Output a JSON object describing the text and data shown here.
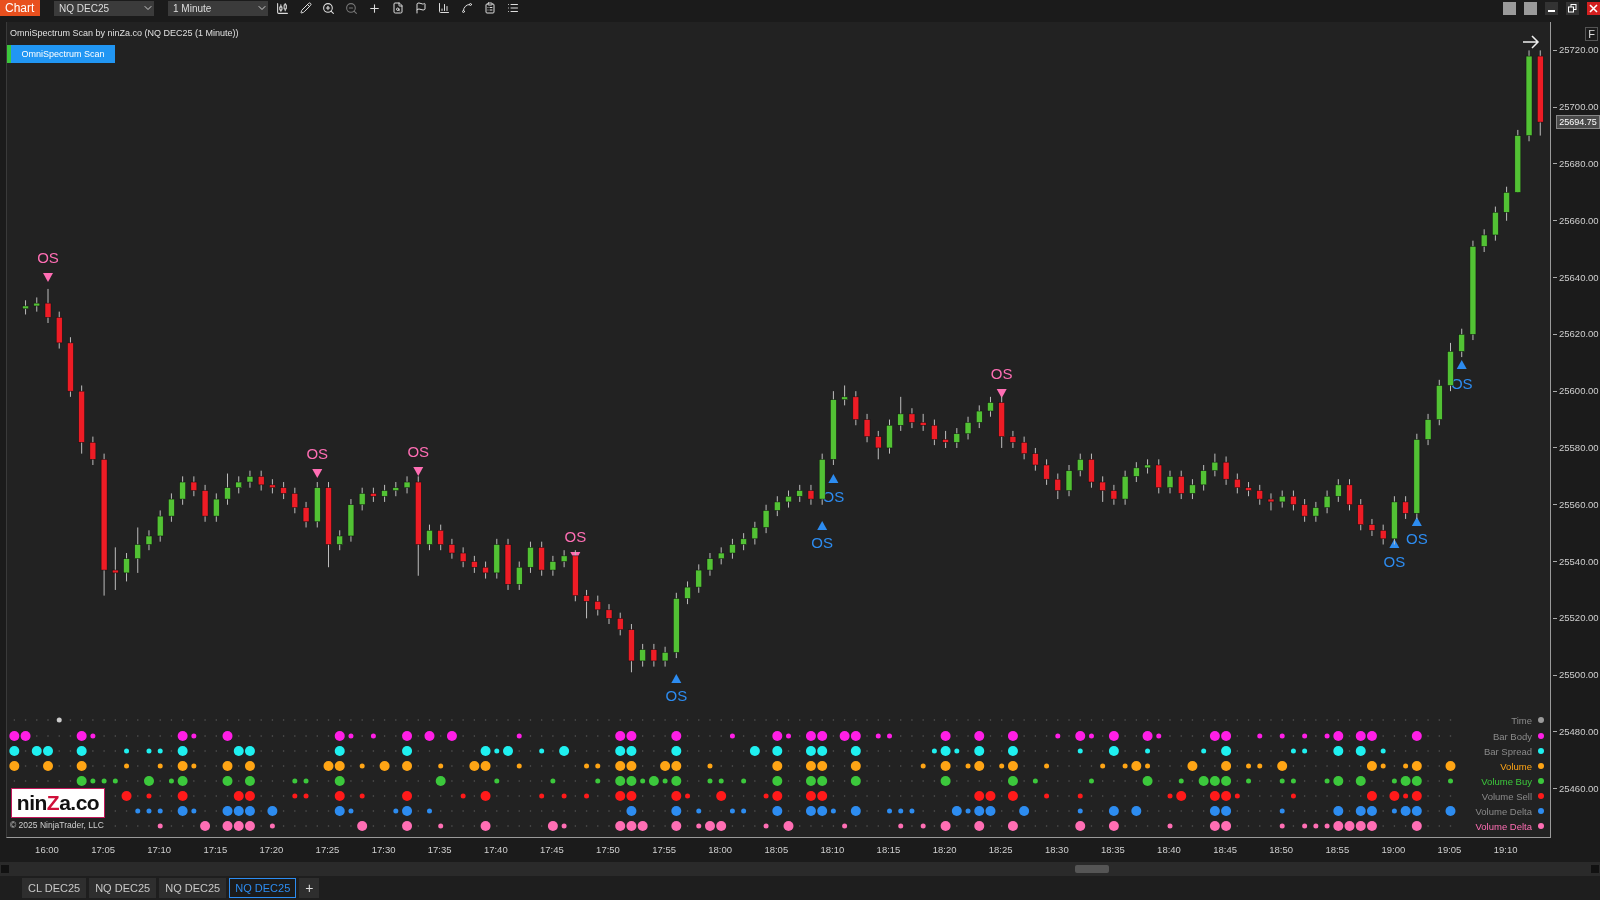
{
  "toolbar": {
    "title": "Chart",
    "instrument": "NQ DEC25",
    "interval": "1 Minute"
  },
  "chart": {
    "title": "OmniSpectrum Scan by ninZa.co (NQ DEC25 (1 Minute))",
    "indicator_button": "OmniSpectrum Scan",
    "axis_button": "F",
    "current_price": "25694.75",
    "signals": [
      {
        "kind": "sell",
        "label": "OS"
      },
      {
        "kind": "sell",
        "label": "OS"
      },
      {
        "kind": "sell",
        "label": "OS"
      },
      {
        "kind": "sell",
        "label": "OS"
      },
      {
        "kind": "buy",
        "label": "OS"
      },
      {
        "kind": "buy",
        "label": "OS"
      },
      {
        "kind": "buy",
        "label": "OS"
      },
      {
        "kind": "sell",
        "label": "OS"
      },
      {
        "kind": "buy",
        "label": "OS"
      },
      {
        "kind": "buy",
        "label": "OS"
      },
      {
        "kind": "buy",
        "label": "OS"
      }
    ],
    "scan_rows": [
      {
        "label": "Time",
        "color": "#9a9a9a",
        "highlighted": false
      },
      {
        "label": "Bar Body",
        "color": "#ff1ee6",
        "highlighted": false
      },
      {
        "label": "Bar Spread",
        "color": "#1ff0f0",
        "highlighted": false
      },
      {
        "label": "Volume",
        "color": "#ffa515",
        "highlighted": true
      },
      {
        "label": "Volume Buy",
        "color": "#3cc83c",
        "highlighted": true
      },
      {
        "label": "Volume Sell",
        "color": "#ff1a1a",
        "highlighted": false
      },
      {
        "label": "Volume Delta",
        "color": "#2d8cf0",
        "highlighted": false
      },
      {
        "label": "Volume Delta",
        "color": "#ff6eb4",
        "highlighted": true
      }
    ],
    "logo": {
      "prefix": "nin",
      "accent": "Z",
      "suffix": "a.co"
    },
    "copyright": "© 2025 NinjaTrader, LLC",
    "chart_data": {
      "type": "candlestick",
      "categories": [
        null,
        null,
        "16:00",
        null,
        null,
        null,
        null,
        "17:05",
        null,
        null,
        null,
        null,
        "17:10",
        null,
        null,
        null,
        null,
        "17:15",
        null,
        null,
        null,
        null,
        "17:20",
        null,
        null,
        null,
        null,
        "17:25",
        null,
        null,
        null,
        null,
        "17:30",
        null,
        null,
        null,
        null,
        "17:35",
        null,
        null,
        null,
        null,
        "17:40",
        null,
        null,
        null,
        null,
        "17:45",
        null,
        null,
        null,
        null,
        "17:50",
        null,
        null,
        null,
        null,
        "17:55",
        null,
        null,
        null,
        null,
        "18:00",
        null,
        null,
        null,
        null,
        "18:05",
        null,
        null,
        null,
        null,
        "18:10",
        null,
        null,
        null,
        null,
        "18:15",
        null,
        null,
        null,
        null,
        "18:20",
        null,
        null,
        null,
        null,
        "18:25",
        null,
        null,
        null,
        null,
        "18:30",
        null,
        null,
        null,
        null,
        "18:35",
        null,
        null,
        null,
        null,
        "18:40",
        null,
        null,
        null,
        null,
        "18:45",
        null,
        null,
        null,
        null,
        "18:50",
        null,
        null,
        null,
        null,
        "18:55",
        null,
        null,
        null,
        null,
        "19:00",
        null,
        null,
        null,
        null,
        "19:05",
        null,
        null,
        null,
        null,
        "19:10",
        null,
        null,
        null
      ],
      "ylim": [
        25443,
        25730
      ],
      "yticks": [
        {
          "value": 25720,
          "label": "25720.00"
        },
        {
          "value": 25700,
          "label": "25700.00"
        },
        {
          "value": 25680,
          "label": "25680.00"
        },
        {
          "value": 25660,
          "label": "25660.00"
        },
        {
          "value": 25640,
          "label": "25640.00"
        },
        {
          "value": 25620,
          "label": "25620.00"
        },
        {
          "value": 25600,
          "label": "25600.00"
        },
        {
          "value": 25580,
          "label": "25580.00"
        },
        {
          "value": 25560,
          "label": "25560.00"
        },
        {
          "value": 25540,
          "label": "25540.00"
        },
        {
          "value": 25520,
          "label": "25520.00"
        },
        {
          "value": 25500,
          "label": "25500.00"
        },
        {
          "value": 25480,
          "label": "25480.00"
        },
        {
          "value": 25460,
          "label": "25460.00"
        }
      ],
      "ohlc": [
        [
          25629,
          25632,
          25627,
          25630
        ],
        [
          25630,
          25633,
          25628,
          25631
        ],
        [
          25631,
          25636,
          25624,
          25626
        ],
        [
          25626,
          25628,
          25615,
          25617
        ],
        [
          25617,
          25619,
          25598,
          25600
        ],
        [
          25600,
          25602,
          25578,
          25582
        ],
        [
          25582,
          25584,
          25574,
          25576
        ],
        [
          25576,
          25578,
          25528,
          25537
        ],
        [
          25537,
          25545,
          25530,
          25536
        ],
        [
          25536,
          25543,
          25533,
          25541
        ],
        [
          25541,
          25552,
          25536,
          25546
        ],
        [
          25546,
          25551,
          25544,
          25549
        ],
        [
          25549,
          25558,
          25547,
          25556
        ],
        [
          25556,
          25564,
          25554,
          25562
        ],
        [
          25562,
          25570,
          25560,
          25568
        ],
        [
          25568,
          25570,
          25563,
          25565
        ],
        [
          25565,
          25567,
          25554,
          25556
        ],
        [
          25556,
          25564,
          25554,
          25562
        ],
        [
          25562,
          25571,
          25560,
          25566
        ],
        [
          25566,
          25570,
          25564,
          25568
        ],
        [
          25568,
          25572,
          25566,
          25570
        ],
        [
          25570,
          25572,
          25565,
          25567
        ],
        [
          25567,
          25569,
          25564,
          25566
        ],
        [
          25566,
          25568,
          25562,
          25564
        ],
        [
          25564,
          25566,
          25557,
          25559
        ],
        [
          25559,
          25561,
          25552,
          25554
        ],
        [
          25554,
          25568,
          25552,
          25566
        ],
        [
          25566,
          25568,
          25538,
          25546
        ],
        [
          25546,
          25551,
          25544,
          25549
        ],
        [
          25549,
          25562,
          25547,
          25560
        ],
        [
          25560,
          25566,
          25558,
          25564
        ],
        [
          25564,
          25566,
          25561,
          25563
        ],
        [
          25563,
          25567,
          25561,
          25565
        ],
        [
          25565,
          25568,
          25563,
          25566
        ],
        [
          25566,
          25570,
          25564,
          25568
        ],
        [
          25568,
          25570,
          25535,
          25546
        ],
        [
          25546,
          25553,
          25544,
          25551
        ],
        [
          25551,
          25553,
          25544,
          25546
        ],
        [
          25546,
          25548,
          25541,
          25543
        ],
        [
          25543,
          25545,
          25538,
          25540
        ],
        [
          25540,
          25542,
          25536,
          25538
        ],
        [
          25538,
          25540,
          25534,
          25536
        ],
        [
          25536,
          25548,
          25534,
          25546
        ],
        [
          25546,
          25548,
          25530,
          25532
        ],
        [
          25532,
          25540,
          25530,
          25538
        ],
        [
          25538,
          25547,
          25536,
          25545
        ],
        [
          25545,
          25547,
          25535,
          25537
        ],
        [
          25537,
          25542,
          25535,
          25540
        ],
        [
          25540,
          25544,
          25538,
          25542
        ],
        [
          25542,
          25544,
          25526,
          25528
        ],
        [
          25528,
          25530,
          25520,
          25526
        ],
        [
          25526,
          25528,
          25521,
          25523
        ],
        [
          25523,
          25525,
          25518,
          25520
        ],
        [
          25520,
          25522,
          25514,
          25516
        ],
        [
          25516,
          25518,
          25501,
          25505
        ],
        [
          25505,
          25511,
          25503,
          25509
        ],
        [
          25509,
          25511,
          25503,
          25505
        ],
        [
          25505,
          25510,
          25503,
          25508
        ],
        [
          25508,
          25529,
          25506,
          25527
        ],
        [
          25527,
          25533,
          25525,
          25531
        ],
        [
          25531,
          25539,
          25529,
          25537
        ],
        [
          25537,
          25543,
          25535,
          25541
        ],
        [
          25541,
          25545,
          25539,
          25543
        ],
        [
          25543,
          25548,
          25541,
          25546
        ],
        [
          25546,
          25550,
          25544,
          25548
        ],
        [
          25548,
          25554,
          25546,
          25552
        ],
        [
          25552,
          25560,
          25550,
          25558
        ],
        [
          25558,
          25563,
          25556,
          25561
        ],
        [
          25561,
          25565,
          25559,
          25563
        ],
        [
          25563,
          25567,
          25561,
          25565
        ],
        [
          25565,
          25567,
          25560,
          25562
        ],
        [
          25562,
          25578,
          25560,
          25576
        ],
        [
          25576,
          25600,
          25574,
          25597
        ],
        [
          25597,
          25602,
          25595,
          25598
        ],
        [
          25598,
          25600,
          25588,
          25590
        ],
        [
          25590,
          25592,
          25582,
          25584
        ],
        [
          25584,
          25586,
          25576,
          25580
        ],
        [
          25580,
          25590,
          25578,
          25588
        ],
        [
          25588,
          25598,
          25586,
          25592
        ],
        [
          25592,
          25594,
          25587,
          25589
        ],
        [
          25589,
          25592,
          25586,
          25588
        ],
        [
          25588,
          25590,
          25581,
          25583
        ],
        [
          25583,
          25586,
          25580,
          25582
        ],
        [
          25582,
          25587,
          25580,
          25585
        ],
        [
          25585,
          25591,
          25583,
          25589
        ],
        [
          25589,
          25595,
          25587,
          25593
        ],
        [
          25593,
          25598,
          25591,
          25596
        ],
        [
          25596,
          25598,
          25580,
          25584
        ],
        [
          25584,
          25586,
          25580,
          25582
        ],
        [
          25582,
          25584,
          25576,
          25578
        ],
        [
          25578,
          25580,
          25572,
          25574
        ],
        [
          25574,
          25576,
          25567,
          25569
        ],
        [
          25569,
          25571,
          25562,
          25565
        ],
        [
          25565,
          25574,
          25563,
          25572
        ],
        [
          25572,
          25578,
          25570,
          25576
        ],
        [
          25576,
          25578,
          25566,
          25568
        ],
        [
          25568,
          25570,
          25561,
          25565
        ],
        [
          25565,
          25567,
          25560,
          25562
        ],
        [
          25562,
          25572,
          25560,
          25570
        ],
        [
          25570,
          25575,
          25568,
          25573
        ],
        [
          25573,
          25576,
          25571,
          25574
        ],
        [
          25574,
          25576,
          25564,
          25566
        ],
        [
          25566,
          25572,
          25564,
          25570
        ],
        [
          25570,
          25572,
          25562,
          25564
        ],
        [
          25564,
          25569,
          25562,
          25567
        ],
        [
          25567,
          25574,
          25565,
          25572
        ],
        [
          25572,
          25578,
          25570,
          25575
        ],
        [
          25575,
          25577,
          25567,
          25569
        ],
        [
          25569,
          25571,
          25564,
          25566
        ],
        [
          25566,
          25568,
          25563,
          25565
        ],
        [
          25565,
          25567,
          25560,
          25562
        ],
        [
          25562,
          25564,
          25558,
          25561
        ],
        [
          25561,
          25565,
          25559,
          25563
        ],
        [
          25563,
          25565,
          25558,
          25560
        ],
        [
          25560,
          25562,
          25554,
          25556
        ],
        [
          25556,
          25561,
          25554,
          25559
        ],
        [
          25559,
          25565,
          25557,
          25563
        ],
        [
          25563,
          25569,
          25561,
          25567
        ],
        [
          25567,
          25569,
          25558,
          25560
        ],
        [
          25560,
          25562,
          25551,
          25553
        ],
        [
          25553,
          25555,
          25549,
          25551
        ],
        [
          25551,
          25553,
          25546,
          25548
        ],
        [
          25548,
          25563,
          25546,
          25561
        ],
        [
          25561,
          25563,
          25555,
          25557
        ],
        [
          25557,
          25585,
          25555,
          25583
        ],
        [
          25583,
          25592,
          25581,
          25590
        ],
        [
          25590,
          25604,
          25588,
          25602
        ],
        [
          25602,
          25617,
          25600,
          25614
        ],
        [
          25614,
          25622,
          25612,
          25620
        ],
        [
          25620,
          25653,
          25618,
          25651
        ],
        [
          25651,
          25657,
          25649,
          25655
        ],
        [
          25655,
          25665,
          25653,
          25663
        ],
        [
          25663,
          25672,
          25660,
          25670
        ],
        [
          25670,
          25692,
          25670,
          25690
        ],
        [
          25690,
          25720,
          25688,
          25718
        ],
        [
          25718,
          25720,
          25690,
          25694.75
        ]
      ]
    }
  },
  "tabs": [
    {
      "label": "CL DEC25",
      "selected": false
    },
    {
      "label": "NQ DEC25",
      "selected": false
    },
    {
      "label": "NQ DEC25",
      "selected": false
    },
    {
      "label": "NQ DEC25",
      "selected": true
    }
  ],
  "add_tab": "+"
}
